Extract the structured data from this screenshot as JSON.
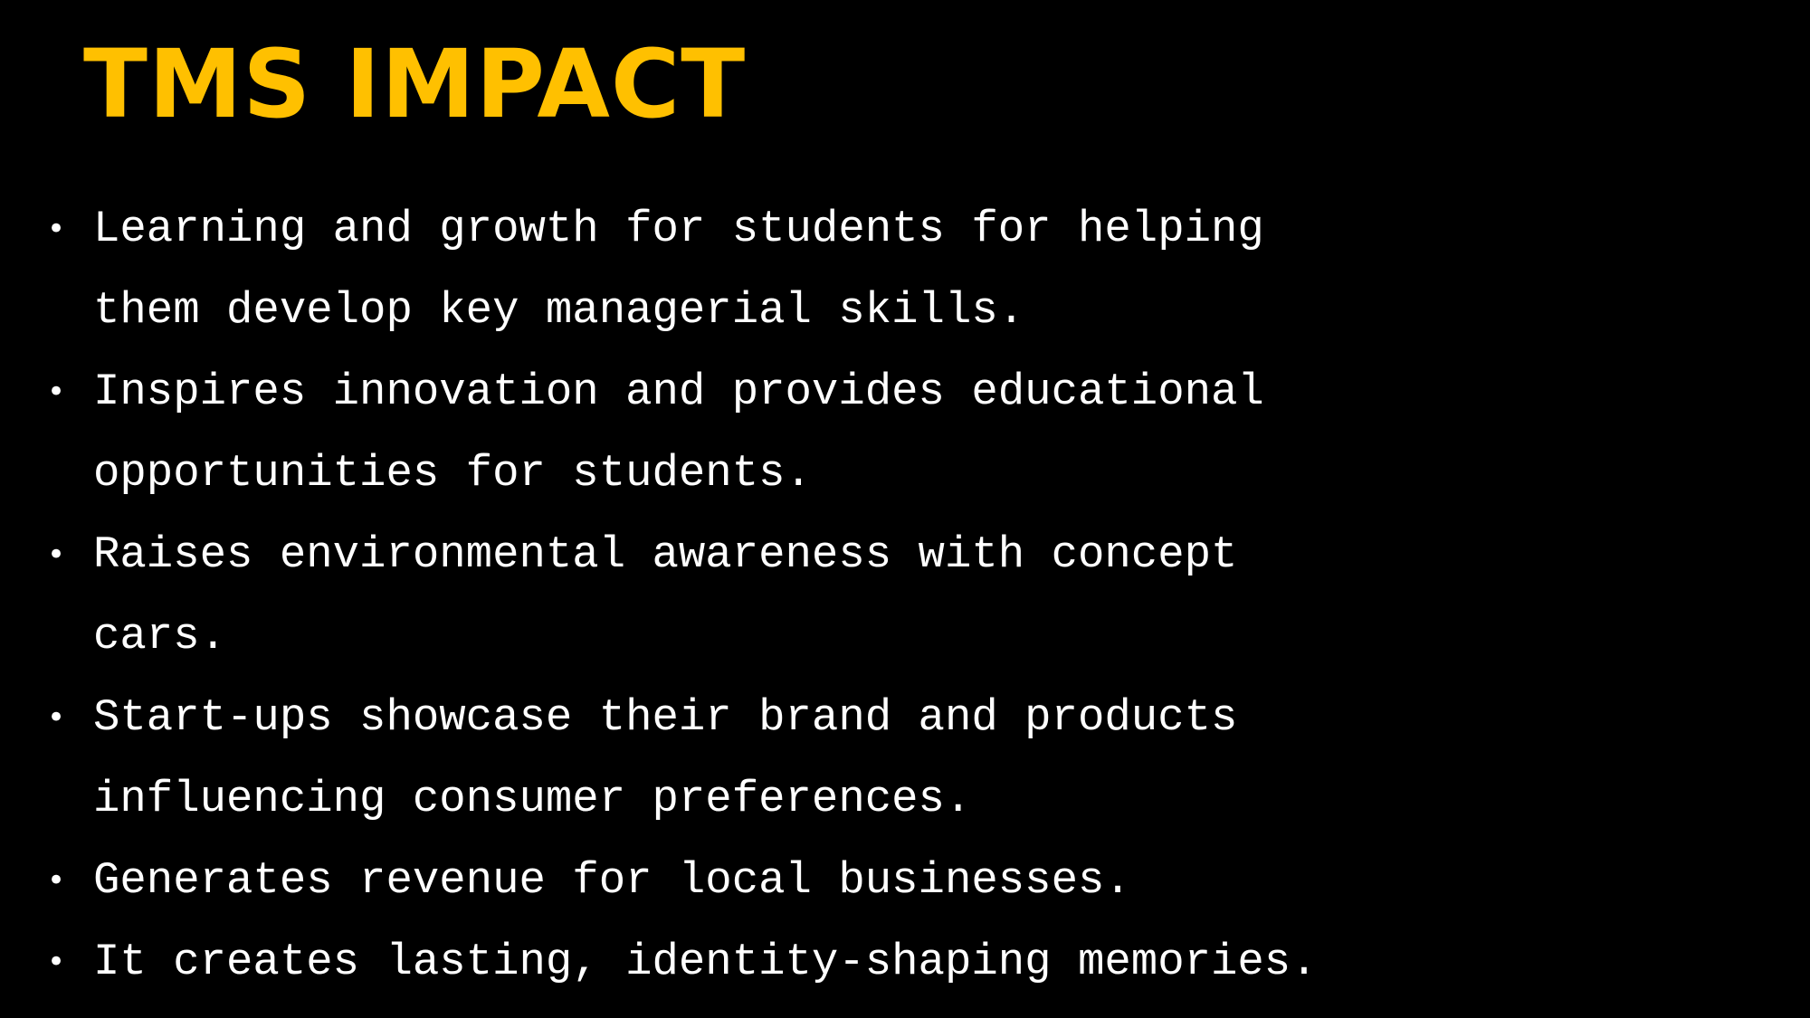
{
  "slide": {
    "title": "TMS IMPACT",
    "colors": {
      "background": "#000000",
      "title": "#FFC000",
      "text": "#FFFFFF"
    },
    "bullet_glyph": "•",
    "bullets": [
      {
        "lines": [
          "Learning and growth for students for helping",
          "them develop key managerial skills."
        ]
      },
      {
        "lines": [
          "Inspires innovation and provides educational",
          "opportunities for students."
        ]
      },
      {
        "lines": [
          "Raises environmental awareness with concept",
          "cars."
        ]
      },
      {
        "lines": [
          "Start-ups showcase their brand and products",
          "influencing consumer preferences."
        ]
      },
      {
        "lines": [
          "Generates revenue for local businesses."
        ]
      },
      {
        "lines": [
          "It creates lasting, identity-shaping memories."
        ]
      }
    ]
  }
}
